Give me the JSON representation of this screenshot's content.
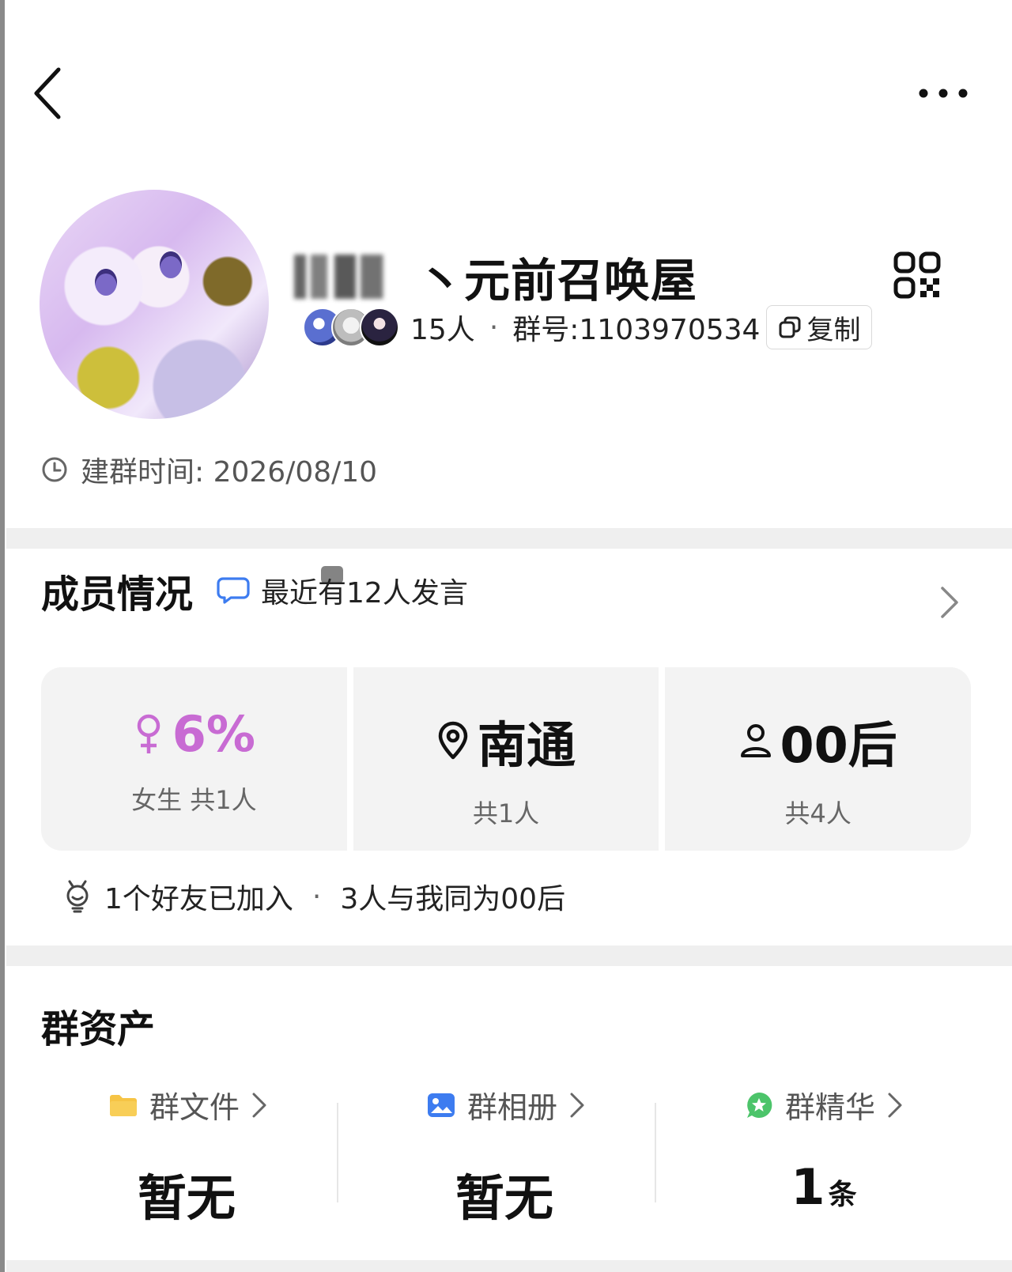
{
  "header": {
    "group_name": "丶元前召唤屋",
    "member_count": "15人",
    "group_id": "群号:1103970534",
    "copy_label": "复制",
    "created": "建群时间: 2026/08/10"
  },
  "members": {
    "title": "成员情况",
    "recent_speakers": "最近有12人发言",
    "stats": [
      {
        "value": "6%",
        "sub": "女生 共1人",
        "icon": "female-icon"
      },
      {
        "value": "南通",
        "sub": "共1人",
        "icon": "location-pin-icon"
      },
      {
        "value": "00后",
        "sub": "共4人",
        "icon": "person-icon"
      }
    ],
    "friends_joined": "1个好友已加入",
    "same_age": "3人与我同为00后"
  },
  "assets": {
    "title": "群资产",
    "items": [
      {
        "label": "群文件",
        "value": "暂无",
        "unit": "",
        "icon": "folder-icon",
        "color": "#f6c445"
      },
      {
        "label": "群相册",
        "value": "暂无",
        "unit": "",
        "icon": "photo-album-icon",
        "color": "#3d7cf0"
      },
      {
        "label": "群精华",
        "value": "1",
        "unit": "条",
        "icon": "essence-star-icon",
        "color": "#4cc46a"
      }
    ]
  },
  "colors": {
    "accent_blue": "#3d7cf0",
    "female_pink": "#c86bd3",
    "divider_gray": "#efefef"
  }
}
